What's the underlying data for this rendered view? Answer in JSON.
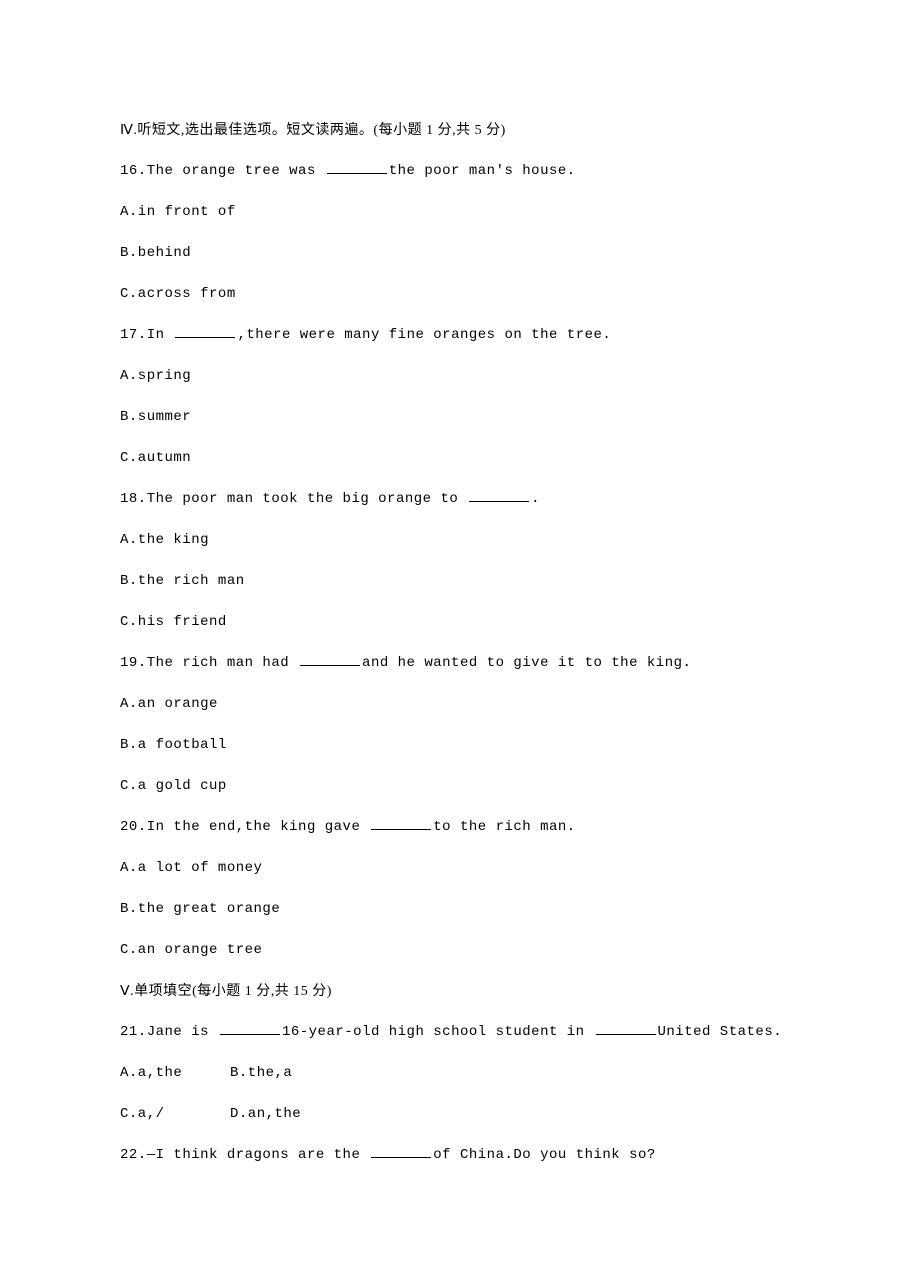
{
  "section4": {
    "header": "Ⅳ.听短文,选出最佳选项。短文读两遍。(每小题 1 分,共 5 分)",
    "questions": [
      {
        "num": "16.",
        "stem_before": "The orange tree was ",
        "stem_after": "the poor man's house.",
        "options": [
          "A.in front of",
          "B.behind",
          "C.across from"
        ]
      },
      {
        "num": "17.",
        "stem_before": "In ",
        "stem_after": ",there were many fine oranges on the tree.",
        "options": [
          "A.spring",
          "B.summer",
          "C.autumn"
        ]
      },
      {
        "num": "18.",
        "stem_before": "The poor man took the big orange to ",
        "stem_after": ".",
        "options": [
          "A.the king",
          "B.the rich man",
          "C.his friend"
        ]
      },
      {
        "num": "19.",
        "stem_before": "The rich man had ",
        "stem_after": "and he wanted to give it to the king.",
        "options": [
          "A.an orange",
          "B.a football",
          "C.a gold cup"
        ]
      },
      {
        "num": "20.",
        "stem_before": "In the end,the king gave ",
        "stem_after": "to the rich man.",
        "options": [
          "A.a lot of money",
          "B.the great orange",
          "C.an orange tree"
        ]
      }
    ]
  },
  "section5": {
    "header": "Ⅴ.单项填空(每小题 1 分,共 15 分)",
    "questions": [
      {
        "num": "21.",
        "stem_parts": [
          "Jane is ",
          "16-year-old high school student in ",
          "United States."
        ],
        "option_rows": [
          [
            "A.a,the",
            "B.the,a"
          ],
          [
            "C.a,/",
            "D.an,the"
          ]
        ]
      },
      {
        "num": "22.",
        "stem_parts": [
          "—I think dragons are the ",
          "of China.Do you think so?"
        ]
      }
    ]
  }
}
